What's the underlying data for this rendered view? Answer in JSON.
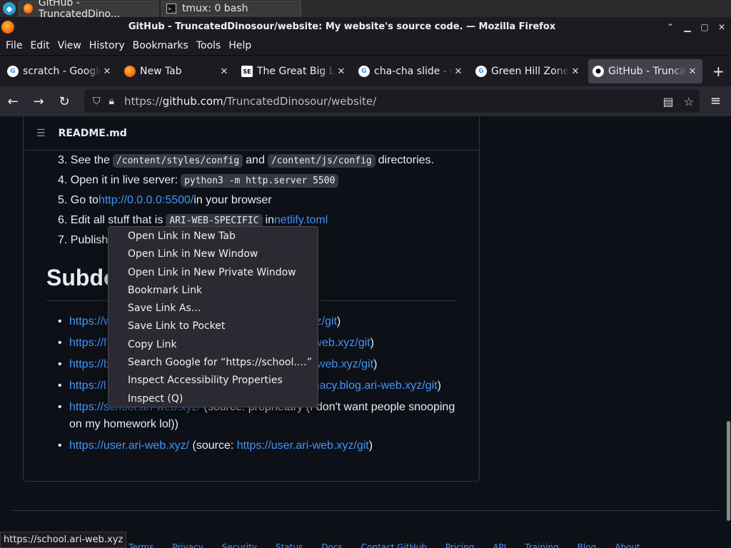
{
  "taskbar": {
    "tasks": [
      {
        "label": "GitHub - TruncatedDino..."
      },
      {
        "label": "tmux: 0 bash"
      }
    ]
  },
  "window": {
    "title": "GitHub - TruncatedDinosour/website: My website's source code. — Mozilla Firefox"
  },
  "menubar": {
    "items": [
      "File",
      "Edit",
      "View",
      "History",
      "Bookmarks",
      "Tools",
      "Help"
    ]
  },
  "tabs": [
    {
      "label": "scratch - Google Docs",
      "icon": "google-icon"
    },
    {
      "label": "New Tab",
      "icon": "firefox-icon"
    },
    {
      "label": "The Great Big List",
      "icon": "stackexchange-icon"
    },
    {
      "label": "cha-cha slide - Google",
      "icon": "google-icon"
    },
    {
      "label": "Green Hill Zone - Google",
      "icon": "google-icon"
    },
    {
      "label": "GitHub - TruncatedDinosour",
      "icon": "github-icon"
    }
  ],
  "urlbar": {
    "scheme": "https://",
    "host": "github.com",
    "path": "/TruncatedDinosour/website/"
  },
  "readme": {
    "title": "README.md",
    "steps": [
      {
        "num": "3.",
        "pre": "See the ",
        "code1": "/content/styles/config",
        "mid": " and ",
        "code2": "/content/js/config",
        "post": " directories."
      },
      {
        "num": "4.",
        "pre": "Open it in live server: ",
        "code1": "python3 -m http.server 5500"
      },
      {
        "num": "5.",
        "pre": "Go to ",
        "link": "http://0.0.0.0:5500/",
        "post": " in your browser"
      },
      {
        "num": "6.",
        "pre": "Edit all stuff that is ",
        "code1": "ARI-WEB-SPECIFIC",
        "mid": " in ",
        "link": "netlify.toml"
      },
      {
        "num": "7.",
        "pre": "Publish"
      }
    ],
    "subheading": "Subdo",
    "bullets": [
      {
        "link": "https://w",
        "tail": "xyz/git",
        "close": ")"
      },
      {
        "link": "https://f",
        "tail": "web.xyz/git",
        "close": ")"
      },
      {
        "link": "https://b",
        "tail": "web.xyz/git",
        "close": ")"
      },
      {
        "link": "https://l",
        "tail": "gacy.blog.ari-web.xyz/git",
        "close": ")"
      },
      {
        "link": "https://school.ari-web.xyz/",
        "text": " (source: proprietary (I don't want people snooping on my homework lol))"
      },
      {
        "link": "https://user.ari-web.xyz/",
        "text": " (source: ",
        "link2": "https://user.ari-web.xyz/git",
        "close": ")"
      }
    ]
  },
  "footer": {
    "links": [
      "Terms",
      "Privacy",
      "Security",
      "Status",
      "Docs",
      "Contact GitHub",
      "Pricing",
      "API",
      "Training",
      "Blog",
      "About"
    ]
  },
  "status": {
    "url": "https://school.ari-web.xyz"
  },
  "context_menu": {
    "items": [
      "Open Link in New Tab",
      "Open Link in New Window",
      "Open Link in New Private Window",
      "Bookmark Link",
      "Save Link As…",
      "Save Link to Pocket",
      "Copy Link",
      "Search Google for “https://school.…”",
      "Inspect Accessibility Properties",
      "Inspect (Q)"
    ]
  }
}
